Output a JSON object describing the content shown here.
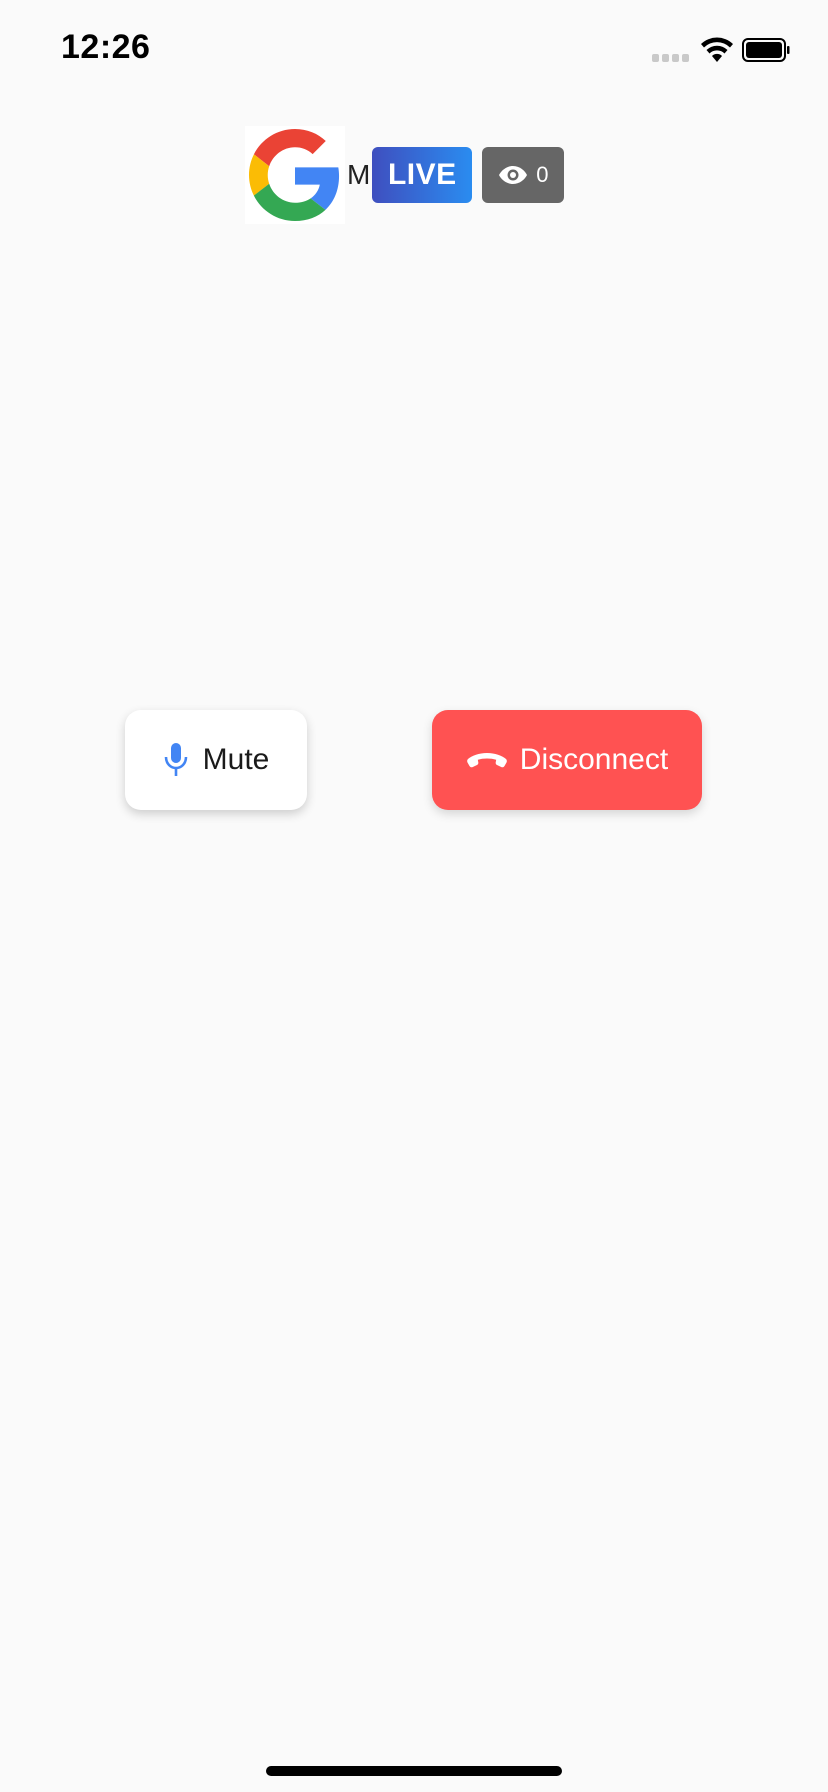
{
  "status_bar": {
    "time": "12:26",
    "icons": [
      "signal-icon",
      "wifi-icon",
      "battery-icon"
    ]
  },
  "header": {
    "logo": "google-logo",
    "host_initial": "M",
    "live_label": "LIVE",
    "viewer_count": "0",
    "viewer_icon": "eye-icon"
  },
  "controls": {
    "mute_label": "Mute",
    "mute_icon": "microphone-icon",
    "disconnect_label": "Disconnect",
    "disconnect_icon": "phone-hangup-icon"
  },
  "colors": {
    "background": "#fafafa",
    "live_gradient_start": "#3f4fbf",
    "live_gradient_end": "#2a8cf0",
    "viewer_badge": "#666666",
    "disconnect": "#ff5252",
    "mic_icon": "#4285f4"
  }
}
